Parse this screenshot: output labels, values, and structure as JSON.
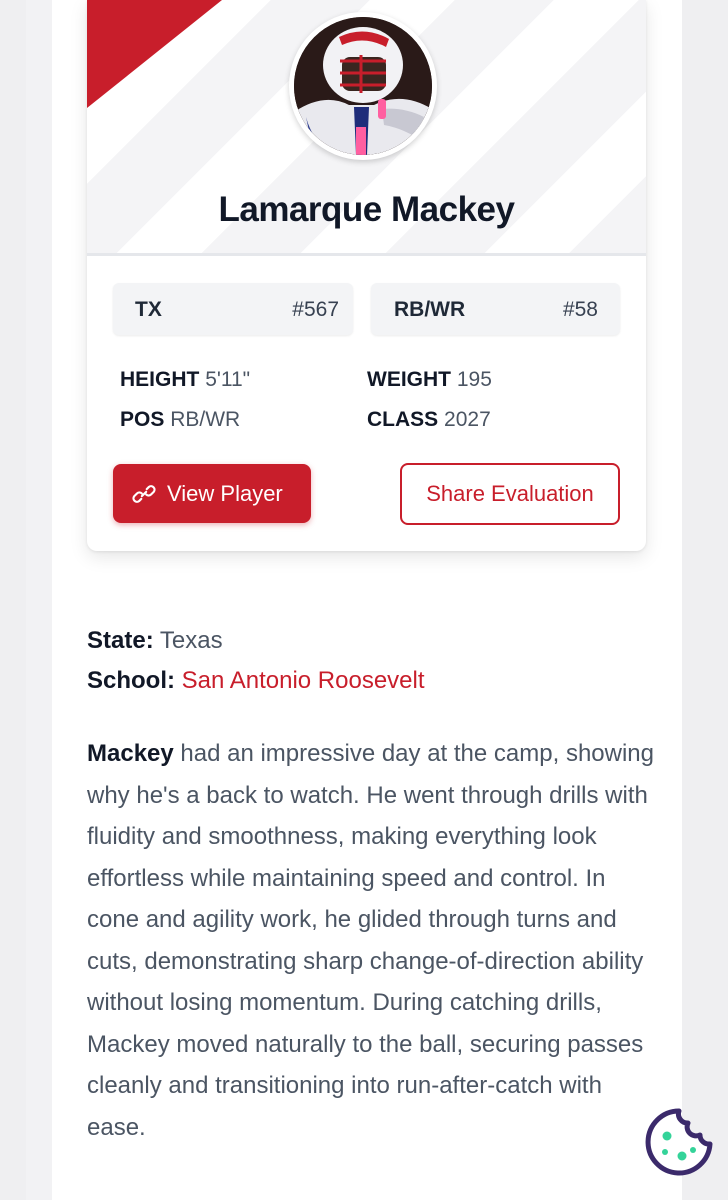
{
  "player": {
    "name": "Lamarque Mackey",
    "state_abbr": "TX",
    "state_rank": "#567",
    "position": "RB/WR",
    "position_rank": "#58",
    "stats": {
      "height_label": "HEIGHT",
      "height": "5'11\"",
      "weight_label": "WEIGHT",
      "weight": "195",
      "pos_label": "POS",
      "pos": "RB/WR",
      "class_label": "CLASS",
      "class": "2027"
    }
  },
  "actions": {
    "view_player": "View Player",
    "share_evaluation": "Share Evaluation"
  },
  "details": {
    "state_label": "State:",
    "state": "Texas",
    "school_label": "School:",
    "school": "San Antonio Roosevelt"
  },
  "evaluation": {
    "lead": "Mackey",
    "text": " had an impressive day at the camp, showing why he's a back to watch. He went through drills with fluidity and smoothness, making everything look effortless while maintaining speed and control. In cone and agility work, he glided through turns and cuts, demonstrating sharp change-of-direction ability without losing momentum. During catching drills, Mackey moved naturally to the ball, securing passes cleanly and transitioning into run-after-catch with ease."
  },
  "colors": {
    "accent": "#c81e2b",
    "cookie": "#3b2a6b"
  },
  "icons": {
    "link": "link-icon",
    "cookie": "cookie-icon"
  }
}
